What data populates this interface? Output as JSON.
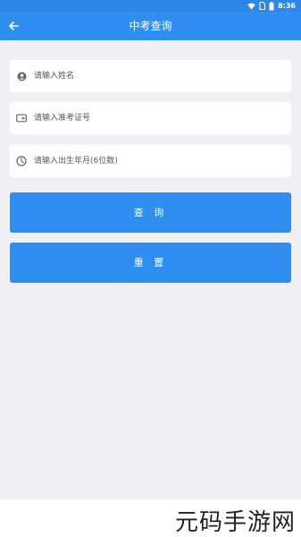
{
  "status_bar": {
    "time": "8:36",
    "icons": [
      "wifi-icon",
      "sim-icon",
      "battery-icon"
    ]
  },
  "app_bar": {
    "title": "中考查询",
    "back_icon": "arrow-left-icon"
  },
  "form": {
    "name": {
      "placeholder": "请输入姓名",
      "value": "",
      "icon": "person-icon"
    },
    "exam_id": {
      "placeholder": "请输入准考证号",
      "value": "",
      "icon": "card-icon"
    },
    "birth": {
      "placeholder": "请输入出生年月(6位数)",
      "value": "",
      "icon": "clock-icon"
    }
  },
  "buttons": {
    "query": "查 询",
    "reset": "重 置"
  },
  "watermark": "元码手游网",
  "colors": {
    "primary": "#2f8ff0",
    "background": "#efeff4",
    "field_bg": "#ffffff"
  }
}
